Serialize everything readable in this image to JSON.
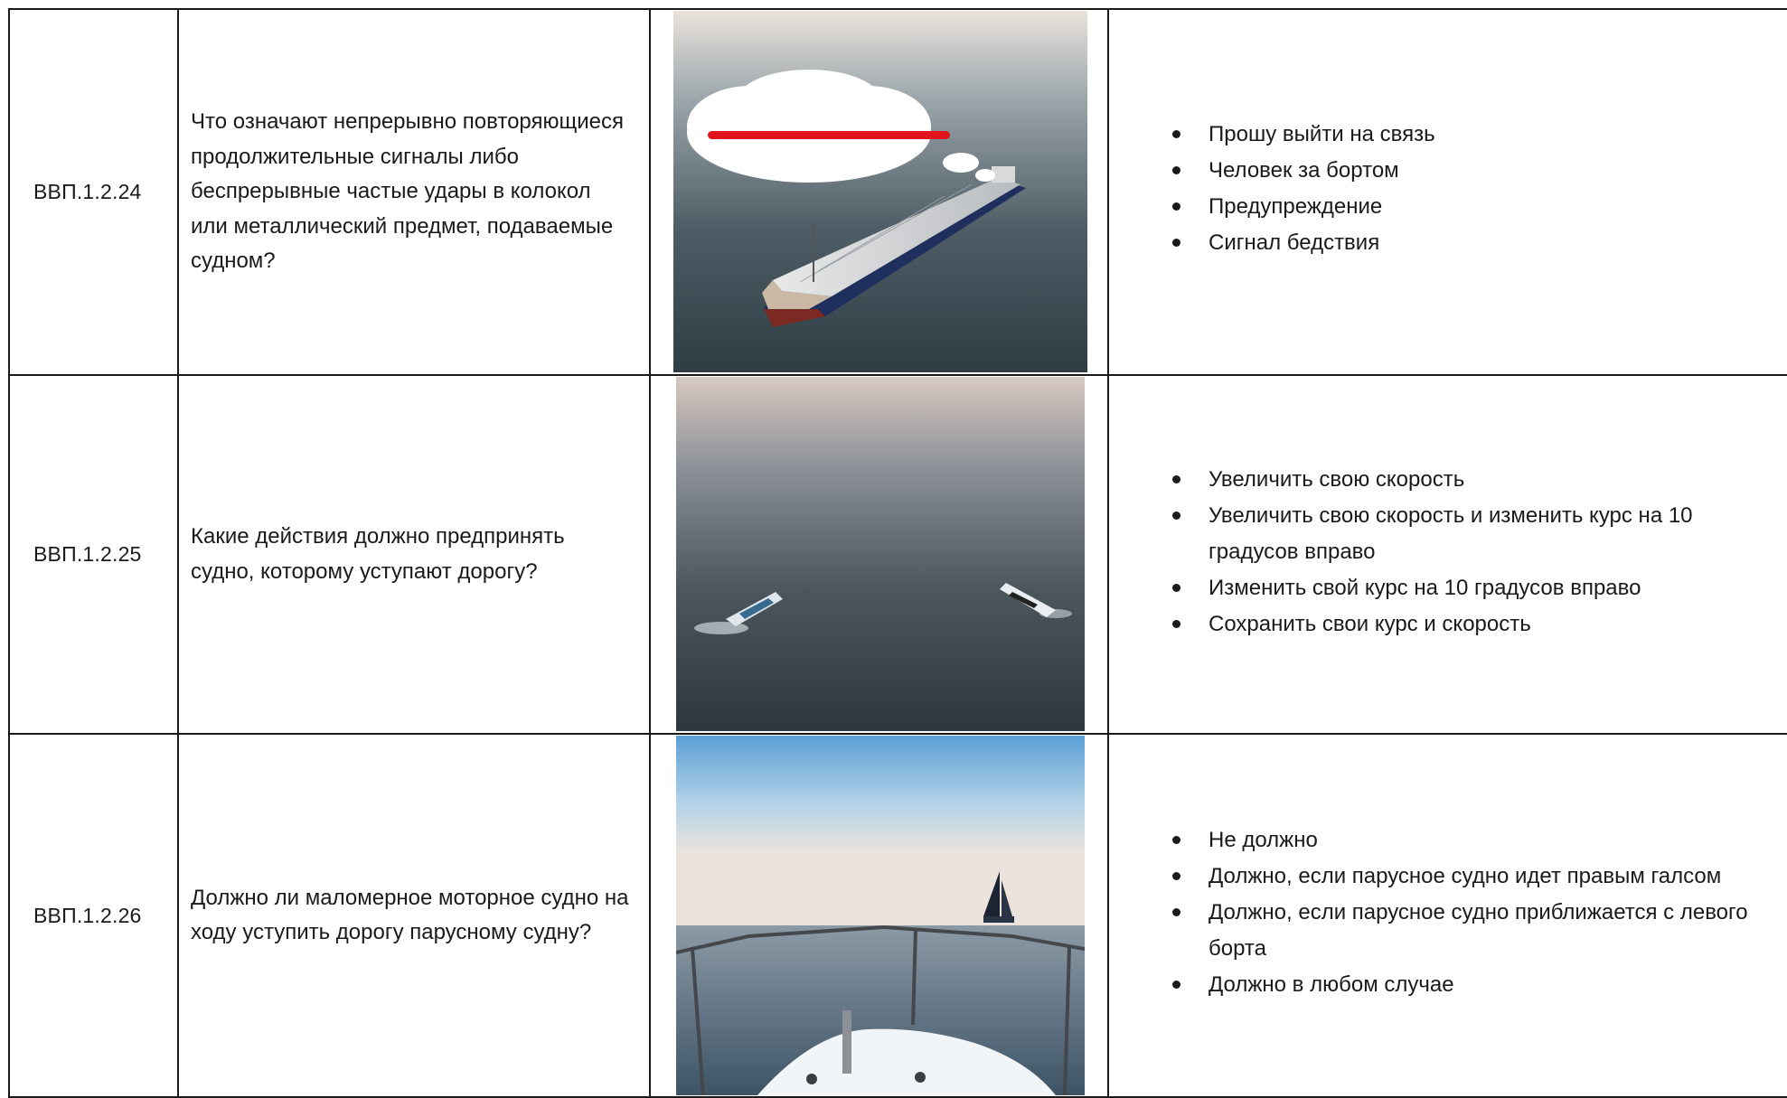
{
  "rows": [
    {
      "code": "ВВП.1.2.24",
      "question": "Что означают непрерывно повторяющиеся продолжительные сигналы либо беспрерывные частые удары в колокол или металлический предмет, подаваемые судном?",
      "image": "cargo-ship-with-long-signal-cloud",
      "answers": [
        "Прошу выйти на связь",
        "Человек за бортом",
        "Предупреждение",
        "Сигнал бедствия"
      ]
    },
    {
      "code": "ВВП.1.2.25",
      "question": "Какие действия должно предпринять судно, которому уступают дорогу?",
      "image": "two-motorboats-at-sea",
      "answers": [
        "Увеличить свою скорость",
        "Увеличить свою скорость и изменить курс на 10 градусов вправо",
        "Изменить свой курс на 10 градусов вправо",
        "Сохранить свои курс и скорость"
      ]
    },
    {
      "code": "ВВП.1.2.26",
      "question": "Должно ли маломерное моторное судно на ходу уступить дорогу парусному судну?",
      "image": "bow-view-with-sailboat",
      "answers": [
        "Не должно",
        "Должно, если парусное судно идет правым галсом",
        "Должно, если парусное судно приближается с левого борта",
        "Должно в любом случае"
      ]
    }
  ]
}
